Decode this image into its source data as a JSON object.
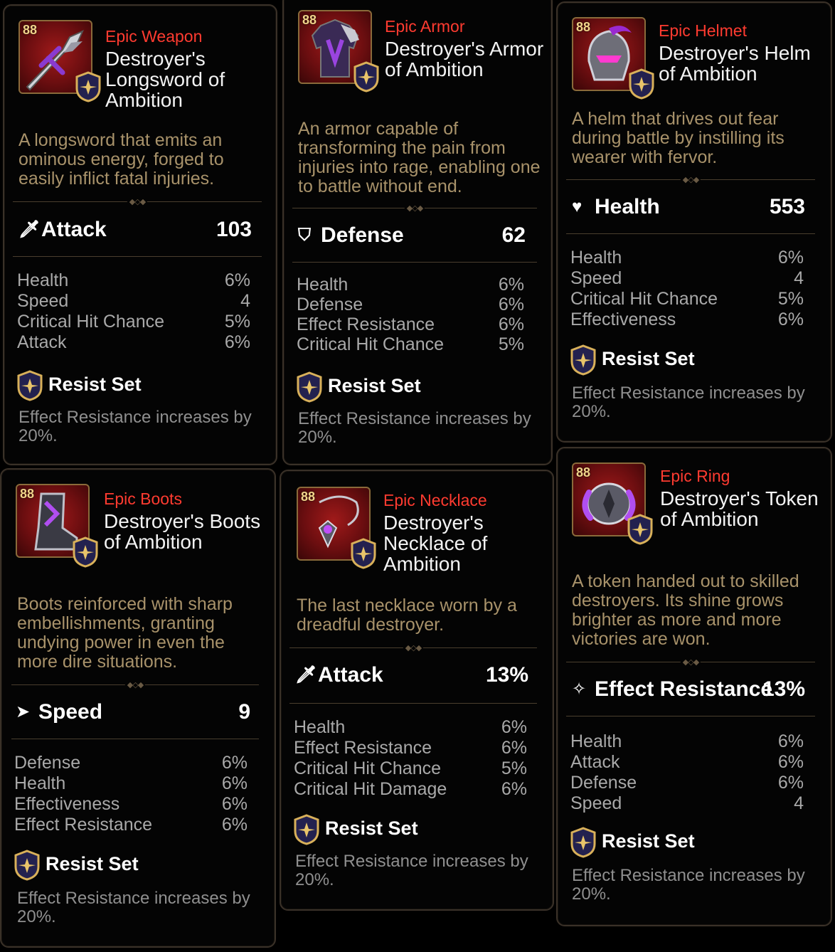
{
  "items": [
    {
      "level": "88",
      "rarity": "Epic Weapon",
      "name": "Destroyer's Longsword of Ambition",
      "description": "A longsword that emits an ominous energy, forged to easily inflict fatal injuries.",
      "main_stat": {
        "icon": "attack-icon",
        "label": "Attack",
        "value": "103"
      },
      "substats": [
        {
          "label": "Health",
          "value": "6%"
        },
        {
          "label": "Speed",
          "value": "4"
        },
        {
          "label": "Critical Hit Chance",
          "value": "5%"
        },
        {
          "label": "Attack",
          "value": "6%"
        }
      ],
      "set_name": "Resist Set",
      "set_effect": "Effect Resistance increases by 20%."
    },
    {
      "level": "88",
      "rarity": "Epic Armor",
      "name": "Destroyer's Armor of Ambition",
      "description": "An armor capable of transforming the pain from injuries into rage, enabling one to battle without end.",
      "main_stat": {
        "icon": "defense-icon",
        "label": "Defense",
        "value": "62"
      },
      "substats": [
        {
          "label": "Health",
          "value": "6%"
        },
        {
          "label": "Defense",
          "value": "6%"
        },
        {
          "label": "Effect Resistance",
          "value": "6%"
        },
        {
          "label": "Critical Hit Chance",
          "value": "5%"
        }
      ],
      "set_name": "Resist Set",
      "set_effect": "Effect Resistance increases by 20%."
    },
    {
      "level": "88",
      "rarity": "Epic Helmet",
      "name": "Destroyer's Helm of Ambition",
      "description": "A helm that drives out fear during battle by instilling its wearer with fervor.",
      "main_stat": {
        "icon": "health-icon",
        "label": "Health",
        "value": "553"
      },
      "substats": [
        {
          "label": "Health",
          "value": "6%"
        },
        {
          "label": "Speed",
          "value": "4"
        },
        {
          "label": "Critical Hit Chance",
          "value": "5%"
        },
        {
          "label": "Effectiveness",
          "value": "6%"
        }
      ],
      "set_name": "Resist Set",
      "set_effect": "Effect Resistance increases by 20%."
    },
    {
      "level": "88",
      "rarity": "Epic Boots",
      "name": "Destroyer's Boots of Ambition",
      "description": "Boots reinforced with sharp embellishments, granting undying power in even the more dire situations.",
      "main_stat": {
        "icon": "speed-icon",
        "label": "Speed",
        "value": "9"
      },
      "substats": [
        {
          "label": "Defense",
          "value": "6%"
        },
        {
          "label": "Health",
          "value": "6%"
        },
        {
          "label": "Effectiveness",
          "value": "6%"
        },
        {
          "label": "Effect Resistance",
          "value": "6%"
        }
      ],
      "set_name": "Resist Set",
      "set_effect": "Effect Resistance increases by 20%."
    },
    {
      "level": "88",
      "rarity": "Epic Necklace",
      "name": "Destroyer's Necklace of Ambition",
      "description": "The last necklace worn by a dreadful destroyer.",
      "main_stat": {
        "icon": "attack-icon",
        "label": "Attack",
        "value": "13%"
      },
      "substats": [
        {
          "label": "Health",
          "value": "6%"
        },
        {
          "label": "Effect Resistance",
          "value": "6%"
        },
        {
          "label": "Critical Hit Chance",
          "value": "5%"
        },
        {
          "label": "Critical Hit Damage",
          "value": "6%"
        }
      ],
      "set_name": "Resist Set",
      "set_effect": "Effect Resistance increases by 20%."
    },
    {
      "level": "88",
      "rarity": "Epic Ring",
      "name": "Destroyer's Token of Ambition",
      "description": "A token handed out to skilled destroyers. Its shine grows brighter as more and more victories are won.",
      "main_stat": {
        "icon": "effect-resistance-icon",
        "label": "Effect Resistance",
        "value": "13%"
      },
      "substats": [
        {
          "label": "Health",
          "value": "6%"
        },
        {
          "label": "Attack",
          "value": "6%"
        },
        {
          "label": "Defense",
          "value": "6%"
        },
        {
          "label": "Speed",
          "value": "4"
        }
      ],
      "set_name": "Resist Set",
      "set_effect": "Effect Resistance increases by 20%."
    }
  ],
  "colors": {
    "rarity": "#ff3b30",
    "description": "#a8926a",
    "substat": "#a9a9a9",
    "accent_gold": "#d8b05a",
    "set_purple": "#2b2a6a"
  }
}
